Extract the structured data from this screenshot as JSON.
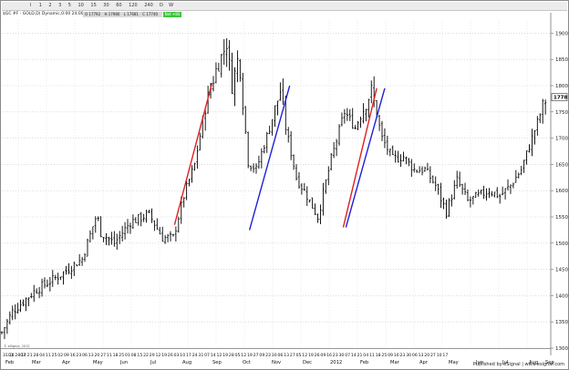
{
  "toolbar": {
    "buttons": [
      "I",
      "1",
      "2",
      "3",
      "5",
      "10",
      "15",
      "30",
      "60",
      "120",
      "240",
      "D",
      "W"
    ]
  },
  "header": {
    "symbol_line": "$GC #F - GOLD,D) Dynamic,0:00 24:00",
    "ohlc": {
      "open": "O 17792",
      "high": "H 17980",
      "low": "L 17681",
      "close": "C 17740"
    },
    "change_badge": "Net +80"
  },
  "footer": {
    "text": "Published by eSignal | www.esignal.com"
  },
  "corner_note": "© eSignal, 2012",
  "chart_data": {
    "type": "candlestick",
    "instrument": "GOLD",
    "ylim": [
      1300,
      1925
    ],
    "yticks": [
      1300,
      1350,
      1400,
      1450,
      1500,
      1550,
      1600,
      1650,
      1700,
      1750,
      1800,
      1850,
      1900
    ],
    "price_label": "1778",
    "anchors": [
      {
        "x": 0.0,
        "close": 1330
      },
      {
        "x": 4.0,
        "close": 1370
      },
      {
        "x": 12.5,
        "close": 1410
      },
      {
        "x": 22.0,
        "close": 1440
      },
      {
        "x": 30.0,
        "close": 1470
      },
      {
        "x": 35.5,
        "close": 1555
      },
      {
        "x": 37.0,
        "close": 1520
      },
      {
        "x": 42.0,
        "close": 1500
      },
      {
        "x": 48.0,
        "close": 1540
      },
      {
        "x": 55.0,
        "close": 1555
      },
      {
        "x": 60.0,
        "close": 1510
      },
      {
        "x": 64.0,
        "close": 1510
      },
      {
        "x": 68.0,
        "close": 1590
      },
      {
        "x": 72.0,
        "close": 1650
      },
      {
        "x": 76.0,
        "close": 1760
      },
      {
        "x": 80.0,
        "close": 1830
      },
      {
        "x": 84.0,
        "close": 1880
      },
      {
        "x": 86.0,
        "close": 1800
      },
      {
        "x": 88.5,
        "close": 1860
      },
      {
        "x": 90.0,
        "close": 1770
      },
      {
        "x": 92.0,
        "close": 1655
      },
      {
        "x": 95.0,
        "close": 1640
      },
      {
        "x": 100.0,
        "close": 1720
      },
      {
        "x": 104.0,
        "close": 1790
      },
      {
        "x": 106.0,
        "close": 1720
      },
      {
        "x": 110.0,
        "close": 1625
      },
      {
        "x": 114.0,
        "close": 1590
      },
      {
        "x": 118.0,
        "close": 1550
      },
      {
        "x": 123.0,
        "close": 1660
      },
      {
        "x": 128.0,
        "close": 1750
      },
      {
        "x": 132.0,
        "close": 1720
      },
      {
        "x": 138.0,
        "close": 1790
      },
      {
        "x": 142.0,
        "close": 1700
      },
      {
        "x": 146.0,
        "close": 1660
      },
      {
        "x": 150.0,
        "close": 1665
      },
      {
        "x": 154.0,
        "close": 1640
      },
      {
        "x": 158.0,
        "close": 1640
      },
      {
        "x": 162.0,
        "close": 1610
      },
      {
        "x": 166.0,
        "close": 1560
      },
      {
        "x": 170.0,
        "close": 1620
      },
      {
        "x": 174.0,
        "close": 1580
      },
      {
        "x": 178.0,
        "close": 1590
      },
      {
        "x": 182.0,
        "close": 1600
      },
      {
        "x": 186.0,
        "close": 1590
      },
      {
        "x": 190.0,
        "close": 1610
      },
      {
        "x": 194.0,
        "close": 1640
      },
      {
        "x": 198.0,
        "close": 1700
      },
      {
        "x": 202.0,
        "close": 1760
      },
      {
        "x": 203.5,
        "close": 1778
      }
    ],
    "trendlines": [
      {
        "color": "#e02020",
        "from": {
          "x": 64.5,
          "y": 1535
        },
        "to": {
          "x": 78.5,
          "y": 1805
        }
      },
      {
        "color": "#2020d8",
        "from": {
          "x": 92.5,
          "y": 1525
        },
        "to": {
          "x": 107.5,
          "y": 1800
        }
      },
      {
        "color": "#e02020",
        "from": {
          "x": 127.5,
          "y": 1530
        },
        "to": {
          "x": 140.0,
          "y": 1795
        }
      },
      {
        "color": "#2020d8",
        "from": {
          "x": 128.5,
          "y": 1530
        },
        "to": {
          "x": 143.0,
          "y": 1795
        }
      }
    ],
    "xaxis_top": [
      "3101",
      "14",
      "2807",
      "14",
      "21",
      "28",
      "04",
      "11",
      "25",
      "02",
      "09",
      "16",
      "23",
      "06",
      "13",
      "20",
      "27",
      "11",
      "18",
      "25",
      "01",
      "08",
      "15",
      "22",
      "29",
      "12",
      "19",
      "26",
      "03",
      "10",
      "17",
      "24",
      "31",
      "07",
      "14",
      "12",
      "19",
      "28",
      "05",
      "12",
      "19",
      "27",
      "09",
      "23",
      "30",
      "06",
      "13",
      "27",
      "05",
      "12",
      "19",
      "26",
      "09",
      "16",
      "23",
      "30",
      "07",
      "14",
      "21",
      "04",
      "11",
      "18",
      "25",
      "09",
      "16",
      "23",
      "30",
      "06",
      "13",
      "20",
      "27",
      "10",
      "17"
    ],
    "xaxis_bottom": [
      "Feb",
      "Mar",
      "Apr",
      "May",
      "Jun",
      "Jul",
      "Aug",
      "Sep",
      "Oct",
      "Nov",
      "Dec",
      "2012",
      "Feb",
      "Mar",
      "Apr",
      "May",
      "Jun",
      "Jul",
      "Aug",
      "Sep"
    ]
  }
}
